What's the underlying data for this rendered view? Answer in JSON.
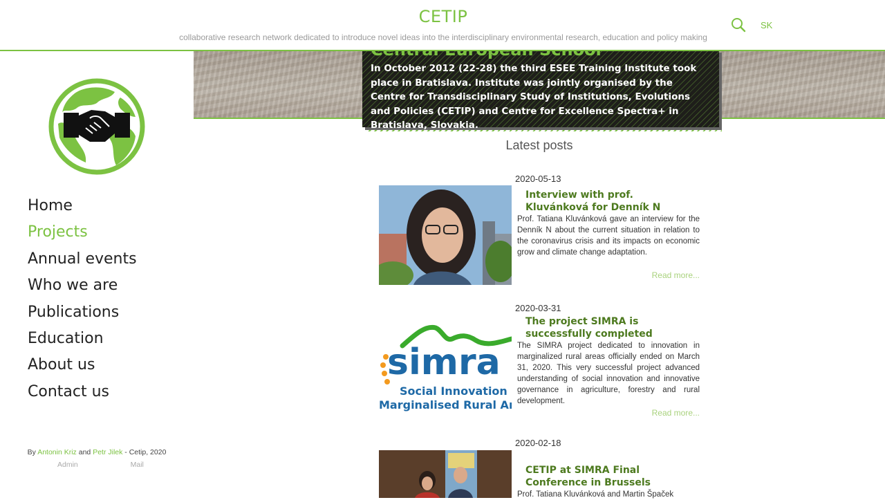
{
  "header": {
    "title": "CETIP",
    "tagline": "collaborative research network dedicated to introduce novel ideas into the interdisciplinary environmental research, education and policy making",
    "lang": "SK",
    "search_icon": "search-icon"
  },
  "hero": {
    "heading": "Central European School",
    "text": "In October 2012 (22-28) the third ESEE Training Institute took place in Bratislava. Institute was jointly organised by the Centre for Transdisciplinary Study of Institutions, Evolutions and Policies (CETIP) and Centre for Excellence Spectra+ in Bratislava, Slovakia."
  },
  "sidebar": {
    "logo_icon": "handshake-globe-logo",
    "nav": [
      {
        "label": "Home"
      },
      {
        "label": "Projects"
      },
      {
        "label": "Annual events"
      },
      {
        "label": "Who we are"
      },
      {
        "label": "Publications"
      },
      {
        "label": "Education"
      },
      {
        "label": "About us"
      },
      {
        "label": "Contact us"
      }
    ],
    "active": "Projects",
    "credits": {
      "by": "By",
      "author1": "Antonin Kriz",
      "and": "and",
      "author2": "Petr Jilek",
      "suffix": "- Cetip, 2020",
      "admin": "Admin",
      "mail": "Mail"
    }
  },
  "main": {
    "latest_title": "Latest posts",
    "read_more": "Read more...",
    "posts": [
      {
        "date": "2020-05-13",
        "title": "Interview with prof. Kluvánková for Denník N",
        "excerpt": "Prof. Tatiana Kluvánková gave an interview for the Denník N about the current situation in relation to the coronavirus crisis and its impacts on economic grow and climate change adaptation."
      },
      {
        "date": "2020-03-31",
        "title": "The project SIMRA is successfully completed",
        "excerpt": "The SIMRA project dedicated to innovation in marginalized rural areas officially ended on March 31, 2020. This very successful project advanced understanding of social innovation and innovative governance in agriculture, forestry and rural development.",
        "image_logo": {
          "word": "simra",
          "line1": "Social Innovation",
          "line2": "Marginalised Rural Areas"
        }
      },
      {
        "date": "2020-02-18",
        "title": "CETIP at SIMRA Final Conference in Brussels",
        "excerpt": "Prof. Tatiana Kluvánková and Martin Špaček"
      }
    ]
  },
  "colors": {
    "accent": "#7cc242",
    "post_title": "#4d7a1f",
    "read_more": "#a9d27d"
  }
}
